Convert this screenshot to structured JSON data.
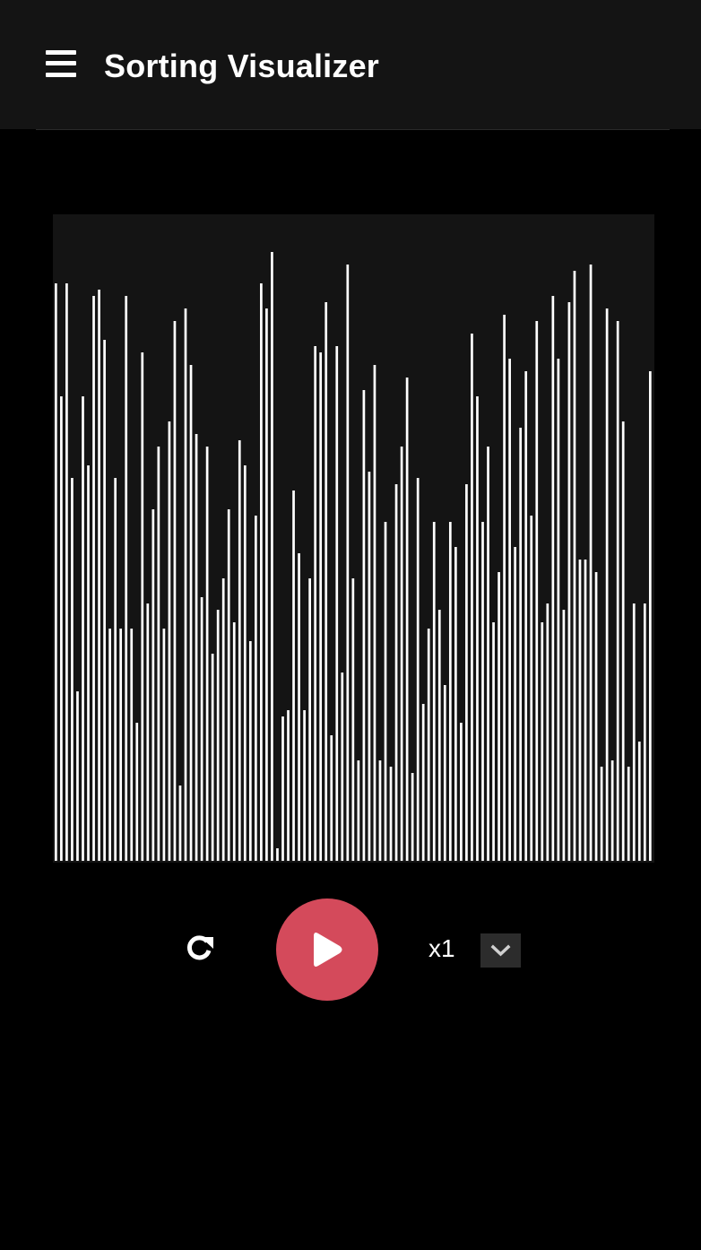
{
  "header": {
    "title": "Sorting Visualizer",
    "menu_icon": "hamburger-menu-icon",
    "background": "#141414"
  },
  "controls": {
    "reset_icon": "refresh-icon",
    "play_icon": "play-icon",
    "play_color": "#d44a5b",
    "speed_label": "x1",
    "speed_dropdown_icon": "chevron-down-icon"
  },
  "chart_data": {
    "type": "bar",
    "bar_color": "#ffffff",
    "panel_color": "#141414",
    "ylim": [
      0,
      100
    ],
    "values": [
      92,
      74,
      92,
      61,
      27,
      74,
      63,
      90,
      91,
      83,
      37,
      61,
      37,
      90,
      37,
      22,
      81,
      41,
      56,
      66,
      37,
      70,
      86,
      12,
      88,
      79,
      68,
      42,
      66,
      33,
      40,
      45,
      56,
      38,
      67,
      63,
      35,
      55,
      92,
      88,
      97,
      2,
      23,
      24,
      59,
      49,
      24,
      45,
      82,
      81,
      89,
      20,
      82,
      30,
      95,
      45,
      16,
      75,
      62,
      79,
      16,
      54,
      15,
      60,
      66,
      77,
      14,
      61,
      25,
      37,
      54,
      40,
      28,
      54,
      50,
      22,
      60,
      84,
      74,
      54,
      66,
      38,
      46,
      87,
      80,
      50,
      69,
      78,
      55,
      86,
      38,
      41,
      90,
      80,
      40,
      89,
      94,
      48,
      48,
      95,
      46,
      15,
      88,
      16,
      86,
      70,
      15,
      41,
      19,
      41,
      78
    ]
  }
}
